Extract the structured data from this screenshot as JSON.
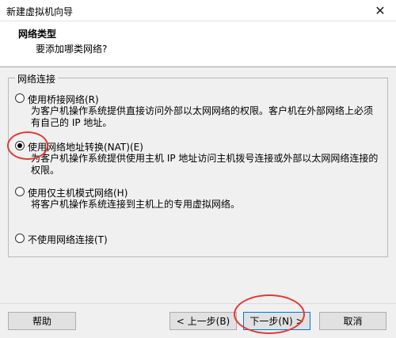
{
  "window": {
    "title": "新建虚拟机向导",
    "close_symbol": "✕"
  },
  "header": {
    "title": "网络类型",
    "subtitle": "要添加哪类网络?"
  },
  "group": {
    "legend": "网络连接"
  },
  "options": [
    {
      "label": "使用桥接网络(R)",
      "desc": "为客户机操作系统提供直接访问外部以太网网络的权限。客户机在外部网络上必须有自己的 IP 地址。",
      "selected": false
    },
    {
      "label": "使用网络地址转换(NAT)(E)",
      "desc": "为客户机操作系统提供使用主机 IP 地址访问主机拨号连接或外部以太网网络连接的权限。",
      "selected": true
    },
    {
      "label": "使用仅主机模式网络(H)",
      "desc": "将客户机操作系统连接到主机上的专用虚拟网络。",
      "selected": false
    },
    {
      "label": "不使用网络连接(T)",
      "desc": "",
      "selected": false
    }
  ],
  "buttons": {
    "help": "帮助",
    "back": "< 上一步(B)",
    "next": "下一步(N) >",
    "cancel": "取消"
  },
  "annotations": {
    "color": "#e53935"
  }
}
